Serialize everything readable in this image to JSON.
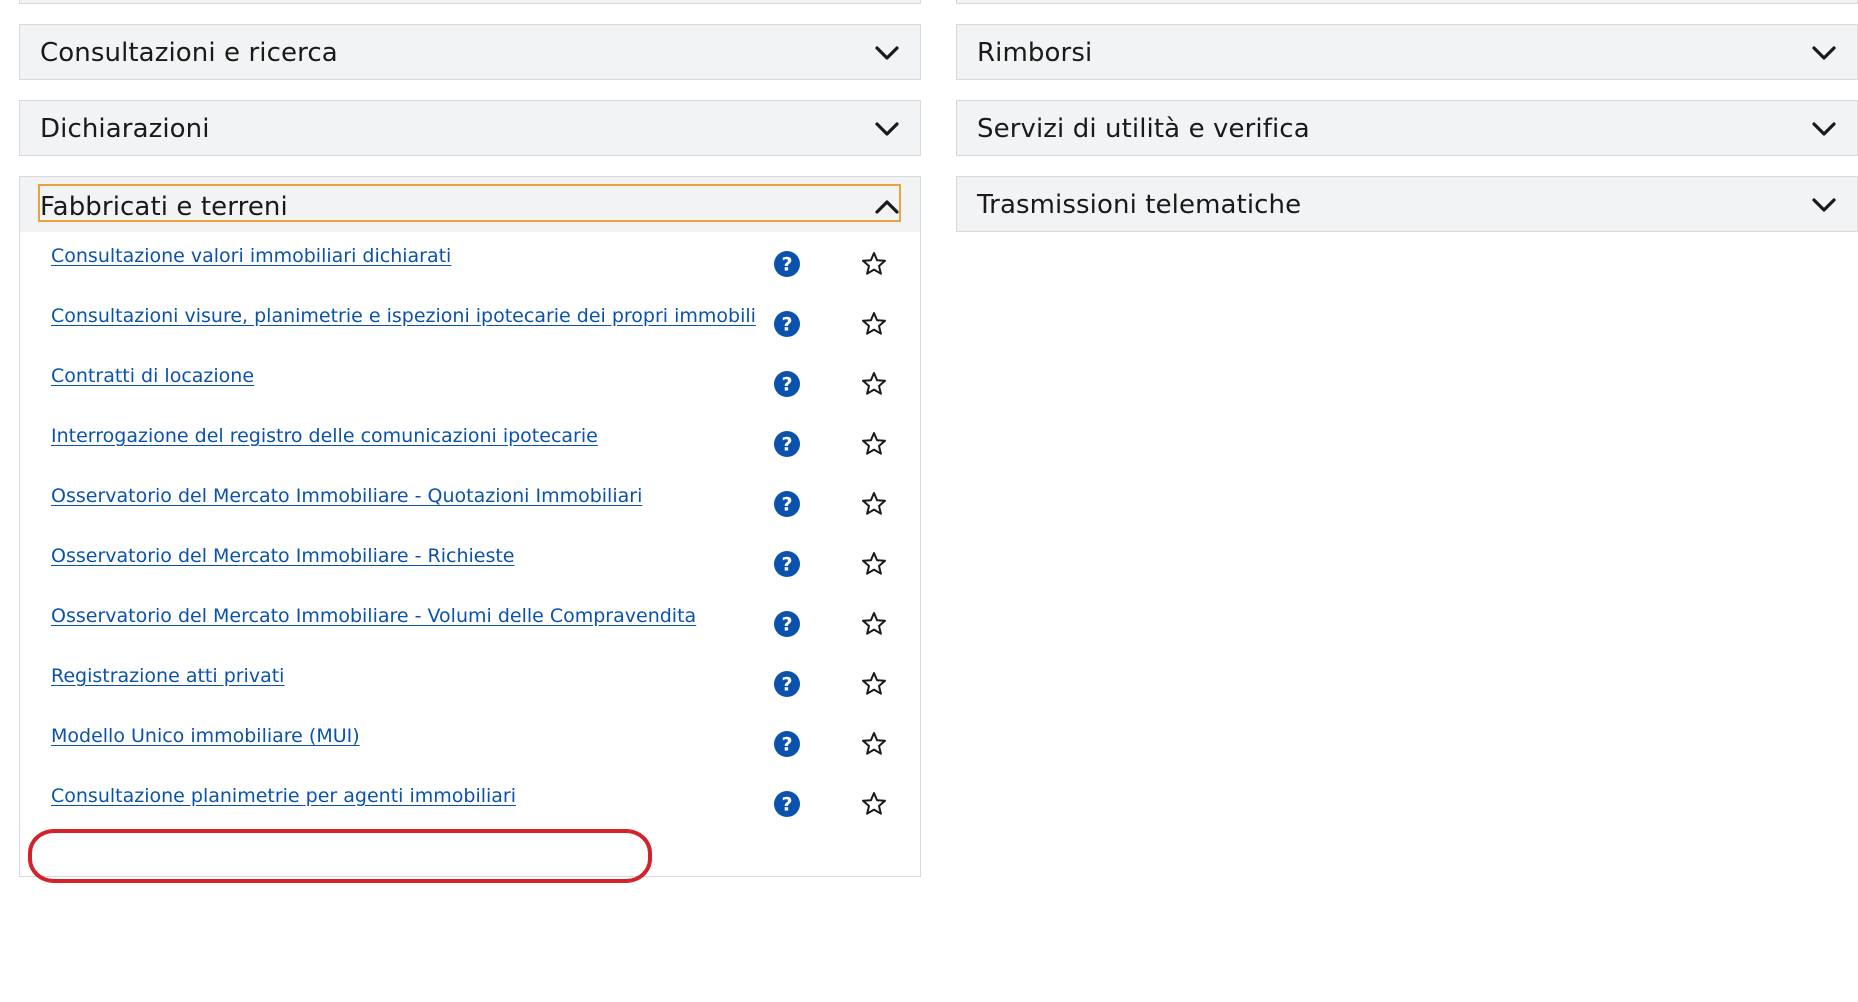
{
  "colors": {
    "header_bg": "#f2f3f4",
    "border": "#d7d9dc",
    "link": "#0b52ac",
    "help_icon": "#0b52ac",
    "focus_ring": "#e8a33d",
    "highlight": "#d3222a"
  },
  "left_column": {
    "sections": [
      {
        "label": "Consultazioni e ricerca",
        "state": "collapsed",
        "icon": "chevron-down-icon"
      },
      {
        "label": "Dichiarazioni",
        "state": "collapsed",
        "icon": "chevron-down-icon"
      },
      {
        "label": "Fabbricati e terreni",
        "state": "expanded",
        "icon": "chevron-up-icon"
      }
    ],
    "expanded_items": [
      {
        "label": "Consultazione valori immobiliari dichiarati"
      },
      {
        "label": "Consultazioni visure, planimetrie e ispezioni ipotecarie dei propri immobili"
      },
      {
        "label": "Contratti di locazione"
      },
      {
        "label": "Interrogazione del registro delle comunicazioni ipotecarie"
      },
      {
        "label": "Osservatorio del Mercato Immobiliare - Quotazioni Immobiliari"
      },
      {
        "label": "Osservatorio del Mercato Immobiliare - Richieste"
      },
      {
        "label": "Osservatorio del Mercato Immobiliare - Volumi delle Compravendita"
      },
      {
        "label": "Registrazione atti privati"
      },
      {
        "label": "Modello Unico immobiliare (MUI)"
      },
      {
        "label": "Consultazione planimetrie per agenti immobiliari",
        "highlighted": true
      }
    ],
    "item_icons": {
      "help": "help-circle-icon",
      "favorite": "star-outline-icon"
    }
  },
  "right_column": {
    "sections": [
      {
        "label": "Rimborsi",
        "state": "collapsed",
        "icon": "chevron-down-icon"
      },
      {
        "label": "Servizi di utilità e verifica",
        "state": "collapsed",
        "icon": "chevron-down-icon"
      },
      {
        "label": "Trasmissioni telematiche",
        "state": "collapsed",
        "icon": "chevron-down-icon"
      }
    ]
  }
}
